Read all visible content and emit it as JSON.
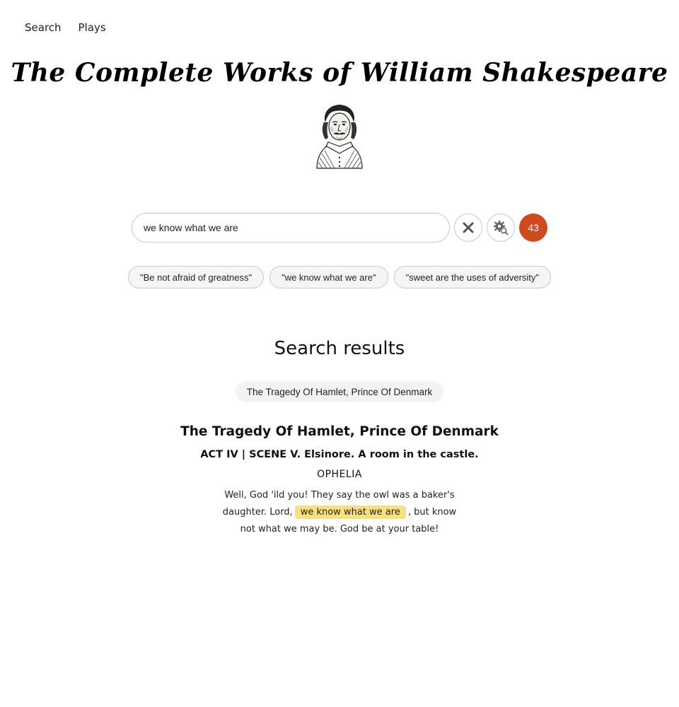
{
  "nav": {
    "search": "Search",
    "plays": "Plays"
  },
  "site": {
    "title": "The Complete Works of William Shakespeare"
  },
  "search": {
    "value": "we know what we are",
    "result_count": "43"
  },
  "suggestions": [
    "\"Be not afraid of greatness\"",
    "\"we know what we are\"",
    "\"sweet are the uses of adversity\""
  ],
  "results": {
    "heading": "Search results",
    "filter": "The Tragedy Of Hamlet, Prince Of Denmark",
    "items": [
      {
        "play": "The Tragedy Of Hamlet, Prince Of Denmark",
        "scene": "ACT IV | SCENE V. Elsinore. A room in the castle.",
        "speaker": "OPHELIA",
        "text_before": "Well, God 'ild you! They say the owl was a baker's daughter. Lord,",
        "highlight": "we know what we are",
        "text_after": ", but know not what we may be. God be at your table!"
      }
    ]
  },
  "colors": {
    "badge": "#cf4a1c",
    "highlight": "#f8e07b"
  },
  "icons": {
    "clear": "close-icon",
    "settings": "search-settings-icon",
    "portrait": "shakespeare-portrait"
  }
}
